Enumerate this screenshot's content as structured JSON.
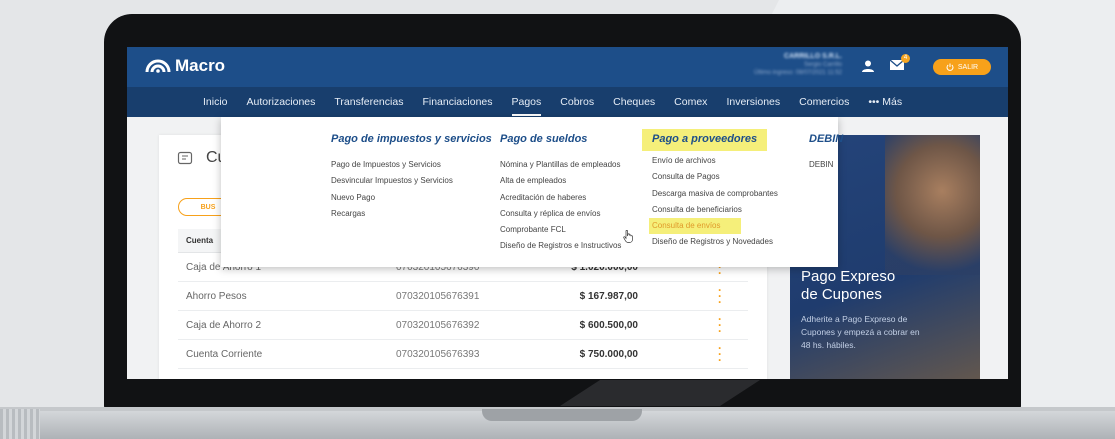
{
  "brand": {
    "name": "Macro"
  },
  "header": {
    "user_name": "CARRILLO S.R.L.",
    "user_sub": "Sergio Carrillo",
    "user_meta": "Último ingreso: 08/07/2021 11:52",
    "notifications_count": "4",
    "logout_label": "SALIR"
  },
  "nav": {
    "items": [
      {
        "label": "Inicio"
      },
      {
        "label": "Autorizaciones"
      },
      {
        "label": "Transferencias"
      },
      {
        "label": "Financiaciones"
      },
      {
        "label": "Pagos"
      },
      {
        "label": "Cobros"
      },
      {
        "label": "Cheques"
      },
      {
        "label": "Comex"
      },
      {
        "label": "Inversiones"
      },
      {
        "label": "Comercios"
      },
      {
        "label": "••• Más"
      }
    ],
    "active": "Pagos"
  },
  "dropdown": {
    "columns": [
      {
        "title": "Pago de impuestos y servicios",
        "items": [
          "Pago de Impuestos y Servicios",
          "Desvincular Impuestos y Servicios",
          "Nuevo Pago",
          "Recargas"
        ]
      },
      {
        "title": "Pago de sueldos",
        "items": [
          "Nómina y Plantillas de empleados",
          "Alta de empleados",
          "Acreditación de haberes",
          "Consulta y réplica de envíos",
          "Comprobante FCL",
          "Diseño de Registros e Instructivos"
        ]
      },
      {
        "title": "Pago a proveedores",
        "items": [
          "Envío de archivos",
          "Consulta de Pagos",
          "Descarga masiva de comprobantes",
          "Consulta de beneficiarios",
          "Consulta de envíos",
          "Diseño de Registros y Novedades"
        ],
        "highlighted_item": "Consulta de envíos"
      },
      {
        "title": "DEBIN",
        "items": [
          "DEBIN"
        ]
      }
    ]
  },
  "accounts": {
    "title": "Cu",
    "button_label": "BUS",
    "column_header": "Cuenta",
    "rows": [
      {
        "name": "Caja de Ahorro 1",
        "number": "070320105676390",
        "balance": "$ 1.020.000,00"
      },
      {
        "name": "Ahorro Pesos",
        "number": "070320105676391",
        "balance": "$ 167.987,00"
      },
      {
        "name": "Caja de Ahorro 2",
        "number": "070320105676392",
        "balance": "$ 600.500,00"
      },
      {
        "name": "Cuenta Corriente",
        "number": "070320105676393",
        "balance": "$ 750.000,00"
      }
    ]
  },
  "promo": {
    "title_line1": "Pago Expreso",
    "title_line2": "de Cupones",
    "text": "Adherite a Pago Expreso de Cupones y empezá a cobrar en 48 hs. hábiles."
  },
  "colors": {
    "topbar": "#1d4e89",
    "navbar": "#183e6d",
    "accent": "#f7a11a",
    "highlight": "#f5ef7a"
  }
}
